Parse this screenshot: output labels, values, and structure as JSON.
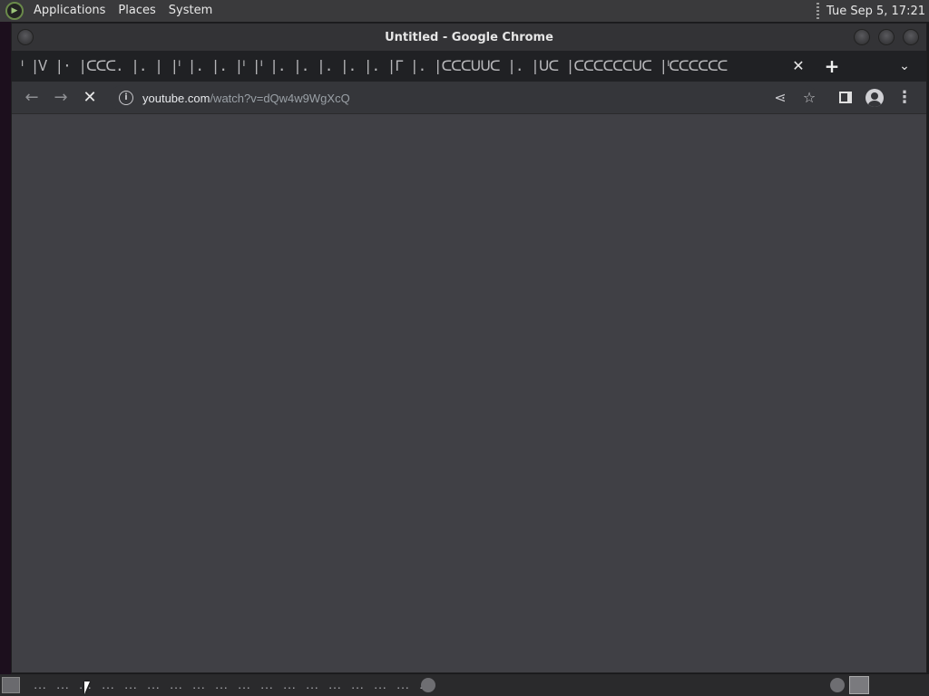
{
  "top_panel": {
    "menus": [
      "Applications",
      "Places",
      "System"
    ],
    "clock": "Tue Sep  5, 17:21"
  },
  "window": {
    "title": "Untitled - Google Chrome"
  },
  "tabstrip": {
    "tabs_text": "ᑊ |Ꮩ |· |ᑕᑕᑕ. |. | |ᑊ |. |. |ᑊ |ᑊ |. |. |. |. |. |ᒥ |. |ᑕᑕᑕᑌᑌᑕ |. |ᑌᑕ |ᑕᑕᑕᑕᑕᑕᑌᑕ |ᑊᑕᑕᑕᑕᑕᑕ",
    "close_label": "✕",
    "new_tab_label": "+",
    "tab_search_label": "⌄"
  },
  "toolbar": {
    "back_label": "←",
    "forward_label": "→",
    "stop_label": "✕",
    "url_host": "youtube.com",
    "url_path": "/watch?v=dQw4w9WgXcQ",
    "share_label": "⋖",
    "star_label": "☆",
    "menu_label": "⋮"
  },
  "bottom_panel": {
    "task_dots": [
      "...",
      "...",
      "...",
      "...",
      "...",
      "...",
      "...",
      "...",
      "...",
      "...",
      "...",
      "...",
      "...",
      "...",
      "...",
      "...",
      "...",
      "..."
    ]
  }
}
